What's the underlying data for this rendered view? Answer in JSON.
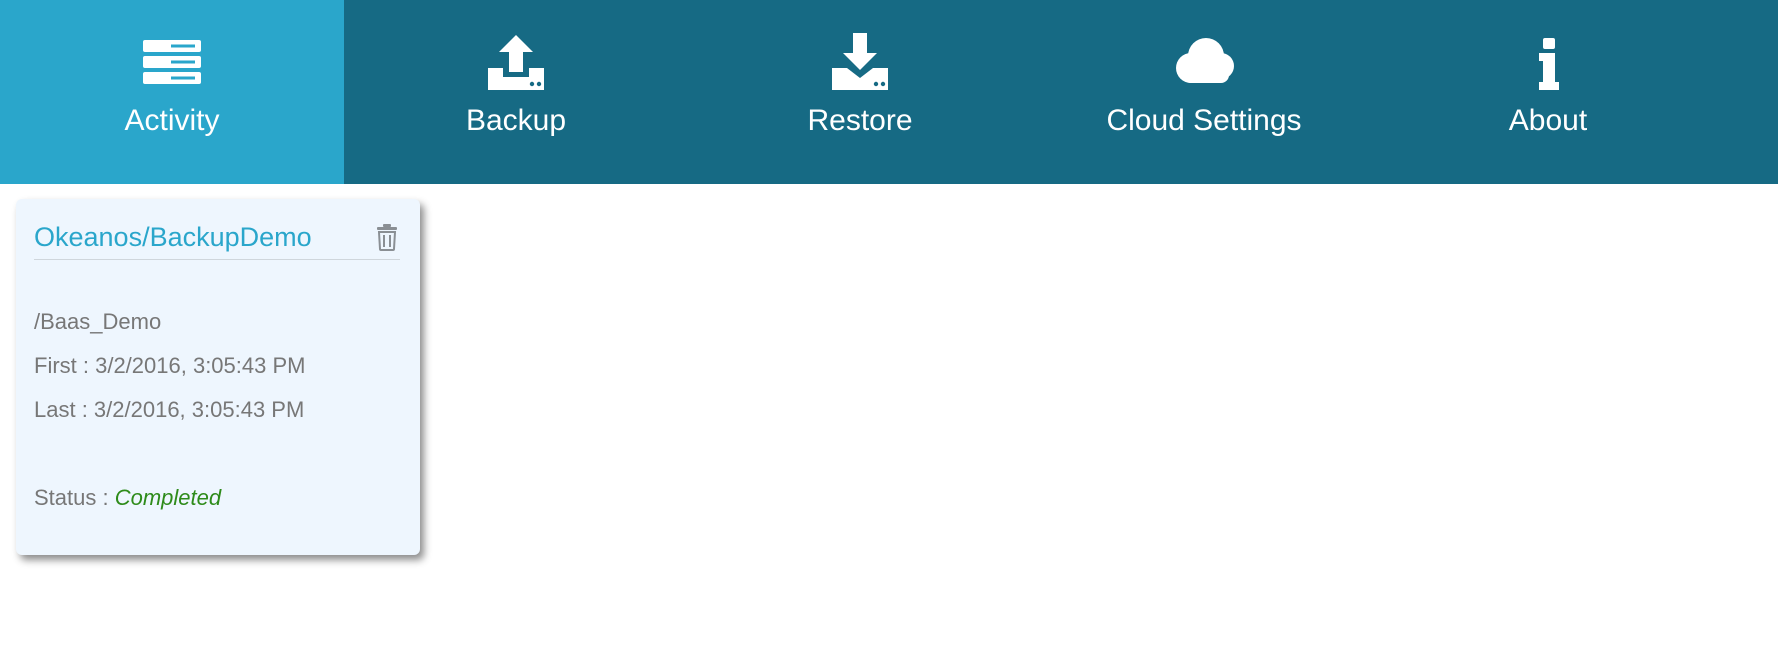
{
  "nav": {
    "tabs": [
      {
        "label": "Activity",
        "icon": "server-list-icon",
        "active": true
      },
      {
        "label": "Backup",
        "icon": "upload-icon",
        "active": false
      },
      {
        "label": "Restore",
        "icon": "download-icon",
        "active": false
      },
      {
        "label": "Cloud Settings",
        "icon": "cloud-icon",
        "active": false
      },
      {
        "label": "About",
        "icon": "info-icon",
        "active": false
      }
    ]
  },
  "card": {
    "title": "Okeanos/BackupDemo",
    "path": "/Baas_Demo",
    "first": "First : 3/2/2016, 3:05:43 PM",
    "last": "Last : 3/2/2016, 3:05:43 PM",
    "status_label": "Status : ",
    "status_value": "Completed",
    "delete_icon": "trash-icon"
  },
  "colors": {
    "nav_background": "#166a84",
    "nav_active": "#2aa6cb",
    "card_background": "#eef6fe",
    "title_color": "#2aa6cb",
    "status_completed": "#2e8b1a"
  }
}
